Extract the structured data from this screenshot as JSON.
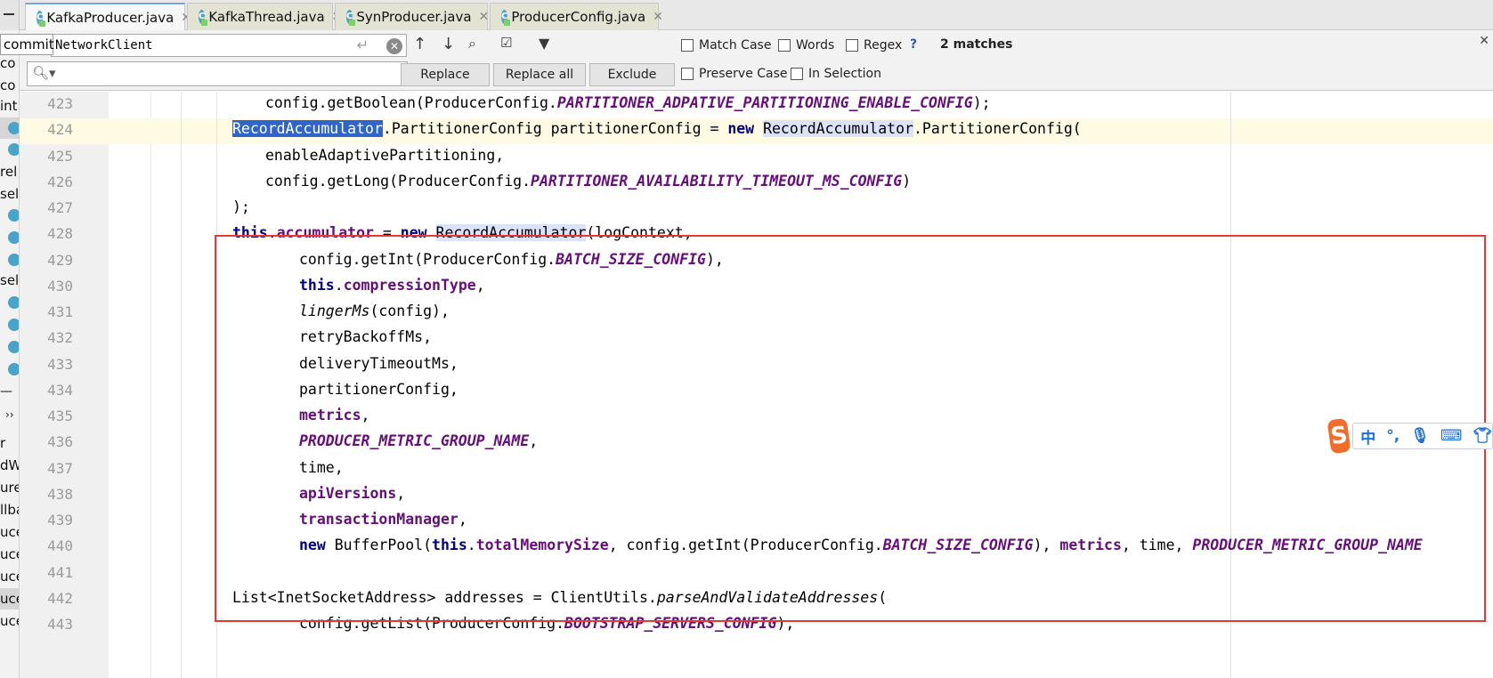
{
  "tabs": [
    {
      "label": "KafkaProducer.java",
      "active": true
    },
    {
      "label": "KafkaThread.java",
      "active": false
    },
    {
      "label": "SynProducer.java",
      "active": false
    },
    {
      "label": "ProducerConfig.java",
      "active": false
    }
  ],
  "sidebar": {
    "popup": "commit",
    "rows": [
      "co",
      "co",
      "int",
      "rel",
      "sel",
      "sel",
      "r",
      "dW",
      "ure",
      "llba",
      "uce",
      "uce",
      "uce",
      "uce",
      "uce"
    ],
    "expand": "››"
  },
  "find": {
    "search_value": "NetworkClient",
    "match_case": "Match Case",
    "words": "Words",
    "regex": "Regex",
    "help": "?",
    "matches": "2 matches",
    "preserve_case": "Preserve Case",
    "in_selection": "In Selection",
    "replace": "Replace",
    "replace_all": "Replace all",
    "exclude": "Exclude"
  },
  "code": {
    "lines": [
      {
        "n": "423",
        "indent": 2,
        "parts": [
          {
            "t": "config.getBoolean(ProducerConfig."
          },
          {
            "t": "PARTITIONER_ADPATIVE_PARTITIONING_ENABLE_CONFIG",
            "c": "cst"
          },
          {
            "t": ");"
          }
        ]
      },
      {
        "n": "424",
        "indent": 1,
        "parts": [
          {
            "t": "RecordAccumulator",
            "c": "sel"
          },
          {
            "t": ".PartitionerConfig partitionerConfig = "
          },
          {
            "t": "new",
            "c": "kw"
          },
          {
            "t": " "
          },
          {
            "t": "RecordAccumulator",
            "c": "hl"
          },
          {
            "t": ".PartitionerConfig("
          }
        ]
      },
      {
        "n": "425",
        "indent": 2,
        "parts": [
          {
            "t": "enableAdaptivePartitioning,"
          }
        ]
      },
      {
        "n": "426",
        "indent": 2,
        "parts": [
          {
            "t": "config.getLong(ProducerConfig."
          },
          {
            "t": "PARTITIONER_AVAILABILITY_TIMEOUT_MS_CONFIG",
            "c": "cst"
          },
          {
            "t": ")"
          }
        ]
      },
      {
        "n": "427",
        "indent": 1,
        "parts": [
          {
            "t": ");"
          }
        ]
      },
      {
        "n": "428",
        "indent": 1,
        "parts": [
          {
            "t": "this",
            "c": "kw"
          },
          {
            "t": "."
          },
          {
            "t": "accumulator",
            "c": "fld"
          },
          {
            "t": " = "
          },
          {
            "t": "new",
            "c": "kw"
          },
          {
            "t": " "
          },
          {
            "t": "RecordAccumulator",
            "c": "hl"
          },
          {
            "t": "(logContext,"
          }
        ]
      },
      {
        "n": "429",
        "indent": 3,
        "parts": [
          {
            "t": "config.getInt(ProducerConfig."
          },
          {
            "t": "BATCH_SIZE_CONFIG",
            "c": "cst"
          },
          {
            "t": "),"
          }
        ]
      },
      {
        "n": "430",
        "indent": 3,
        "parts": [
          {
            "t": "this",
            "c": "kw"
          },
          {
            "t": "."
          },
          {
            "t": "compressionType",
            "c": "fld"
          },
          {
            "t": ","
          }
        ]
      },
      {
        "n": "431",
        "indent": 3,
        "parts": [
          {
            "t": "lingerMs",
            "c": "itl"
          },
          {
            "t": "(config),"
          }
        ]
      },
      {
        "n": "432",
        "indent": 3,
        "parts": [
          {
            "t": "retryBackoffMs,"
          }
        ]
      },
      {
        "n": "433",
        "indent": 3,
        "parts": [
          {
            "t": "deliveryTimeoutMs,"
          }
        ]
      },
      {
        "n": "434",
        "indent": 3,
        "parts": [
          {
            "t": "partitionerConfig,"
          }
        ]
      },
      {
        "n": "435",
        "indent": 3,
        "parts": [
          {
            "t": "metrics",
            "c": "fld"
          },
          {
            "t": ","
          }
        ]
      },
      {
        "n": "436",
        "indent": 3,
        "parts": [
          {
            "t": "PRODUCER_METRIC_GROUP_NAME",
            "c": "cst"
          },
          {
            "t": ","
          }
        ]
      },
      {
        "n": "437",
        "indent": 3,
        "parts": [
          {
            "t": "time,"
          }
        ]
      },
      {
        "n": "438",
        "indent": 3,
        "parts": [
          {
            "t": "apiVersions",
            "c": "fld"
          },
          {
            "t": ","
          }
        ]
      },
      {
        "n": "439",
        "indent": 3,
        "parts": [
          {
            "t": "transactionManager",
            "c": "fld"
          },
          {
            "t": ","
          }
        ]
      },
      {
        "n": "440",
        "indent": 3,
        "parts": [
          {
            "t": "new",
            "c": "kw"
          },
          {
            "t": " BufferPool("
          },
          {
            "t": "this",
            "c": "kw"
          },
          {
            "t": "."
          },
          {
            "t": "totalMemorySize",
            "c": "fld"
          },
          {
            "t": ", config.getInt(ProducerConfig."
          },
          {
            "t": "BATCH_SIZE_CONFIG",
            "c": "cst"
          },
          {
            "t": "), "
          },
          {
            "t": "metrics",
            "c": "fld"
          },
          {
            "t": ", time, "
          },
          {
            "t": "PRODUCER_METRIC_GROUP_NAME",
            "c": "cst"
          }
        ]
      },
      {
        "n": "441",
        "indent": 1,
        "parts": []
      },
      {
        "n": "442",
        "indent": 1,
        "parts": [
          {
            "t": "List<InetSocketAddress> addresses = ClientUtils."
          },
          {
            "t": "parseAndValidateAddresses",
            "c": "itl"
          },
          {
            "t": "("
          }
        ]
      },
      {
        "n": "443",
        "indent": 3,
        "parts": [
          {
            "t": "config.getList(ProducerConfig."
          },
          {
            "t": "BOOTSTRAP_SERVERS_CONFIG",
            "c": "cst"
          },
          {
            "t": "),"
          }
        ]
      }
    ]
  },
  "ime": {
    "logo": "S",
    "lang": "中",
    "items": [
      "°,",
      "mic-icon",
      "keyboard-icon",
      "shirt-icon"
    ]
  },
  "colors": {
    "keyword": "#000080",
    "field": "#660e7a",
    "selection": "#2f65ca",
    "highlight_box": "#e53935"
  }
}
